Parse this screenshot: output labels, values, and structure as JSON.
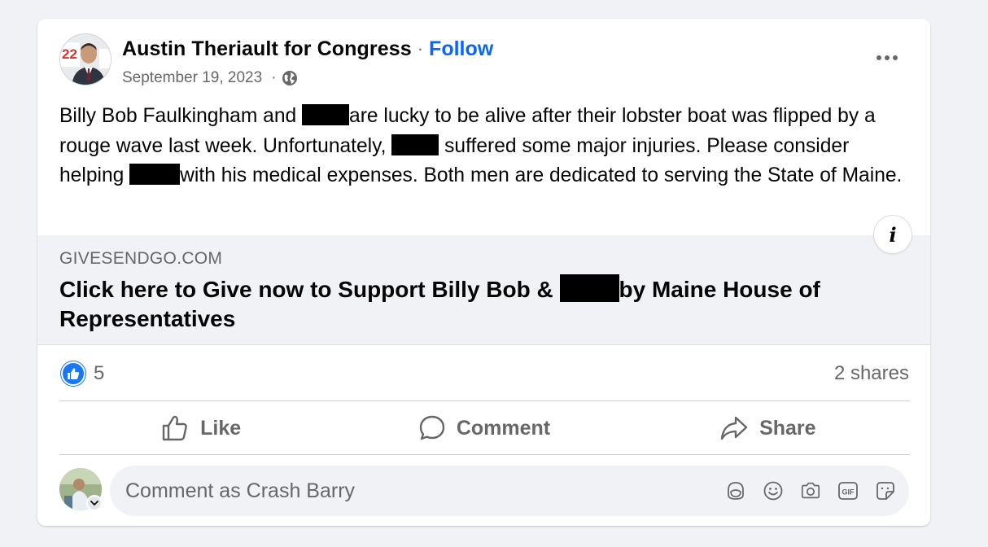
{
  "post": {
    "author": "Austin Theriault for Congress",
    "separator": "·",
    "follow_label": "Follow",
    "date": "September 19, 2023",
    "meta_separator": "·",
    "text": {
      "p1": "Billy Bob Faulkingham and ",
      "p2": "are lucky to be alive after their lobster boat was flipped by a rouge wave last week. Unfortunately, ",
      "p3": " suffered some major injuries. Please consider helping ",
      "p4": "with his medical expenses. Both men are dedicated to serving the State of Maine."
    }
  },
  "avatar": {
    "badge_number": "22"
  },
  "link_preview": {
    "domain": "GIVESENDGO.COM",
    "title_part1": "Click here to Give now to Support Billy Bob & ",
    "title_part2": "by Maine House of Representatives"
  },
  "engagement": {
    "reaction_count": "5",
    "shares": "2 shares"
  },
  "actions": {
    "like_label": "Like",
    "comment_label": "Comment",
    "share_label": "Share"
  },
  "composer": {
    "placeholder": "Comment as Crash Barry"
  },
  "icons": {
    "more": "more-horizontal-icon",
    "privacy": "globe-icon",
    "info": "info-icon",
    "like_badge": "thumbs-up-icon",
    "like": "thumbs-up-outline-icon",
    "comment": "speech-bubble-icon",
    "share": "share-arrow-icon",
    "tools": [
      "avatar-sticker-icon",
      "emoji-icon",
      "camera-icon",
      "gif-icon",
      "sticker-icon"
    ]
  },
  "colors": {
    "link_blue": "#0866ff",
    "like_blue": "#1a77f2",
    "secondary_text": "#65676b",
    "background": "#f0f2f5"
  }
}
